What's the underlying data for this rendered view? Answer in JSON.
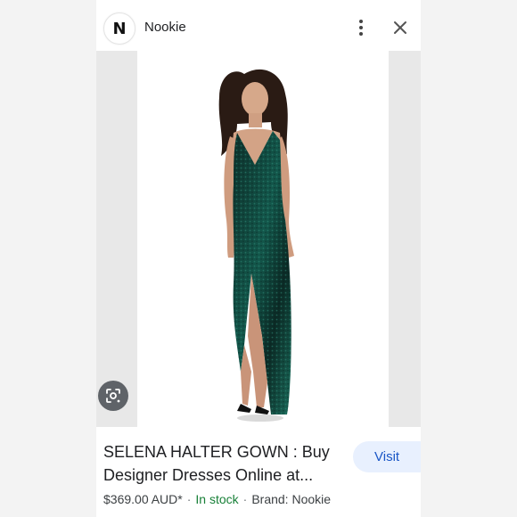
{
  "header": {
    "logo_letter": "N",
    "site_name": "Nookie"
  },
  "product": {
    "title": "SELENA HALTER GOWN : Buy Designer Dresses Online at...",
    "price": "$369.00 AUD*",
    "separator": "·",
    "stock": "In stock",
    "brand": "Brand: Nookie"
  },
  "actions": {
    "visit_label": "Visit"
  },
  "icons": {
    "more": "more-vertical-icon",
    "close": "close-icon",
    "lens": "lens-icon"
  },
  "colors": {
    "dress": "#0f3a33",
    "accent_blue": "#1a56c6",
    "stock_green": "#188038"
  }
}
